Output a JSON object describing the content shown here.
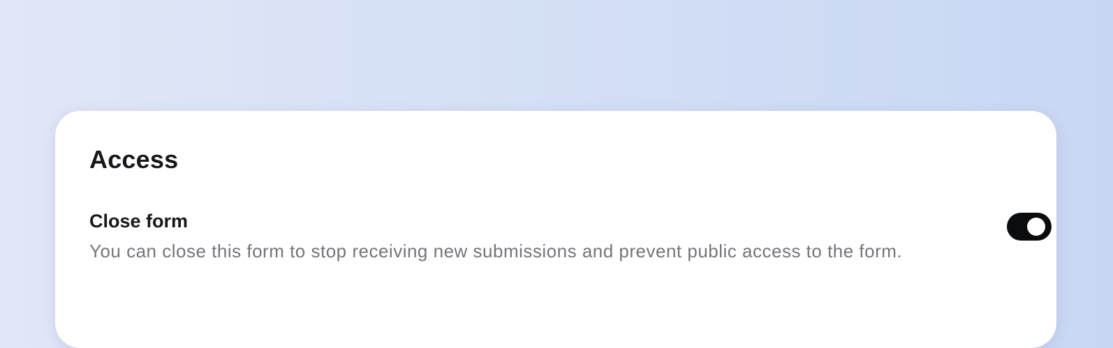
{
  "access": {
    "title": "Access",
    "close_form": {
      "label": "Close form",
      "description": "You can close this form to stop receiving new submissions and prevent public access to the form.",
      "enabled": true
    }
  },
  "colors": {
    "toggle_on": "#0b0c0e",
    "label_text": "#16171a",
    "description_text": "#74757c",
    "card_background": "#ffffff",
    "page_gradient_start": "#e1e7f7",
    "page_gradient_end": "#c9d7f3"
  }
}
